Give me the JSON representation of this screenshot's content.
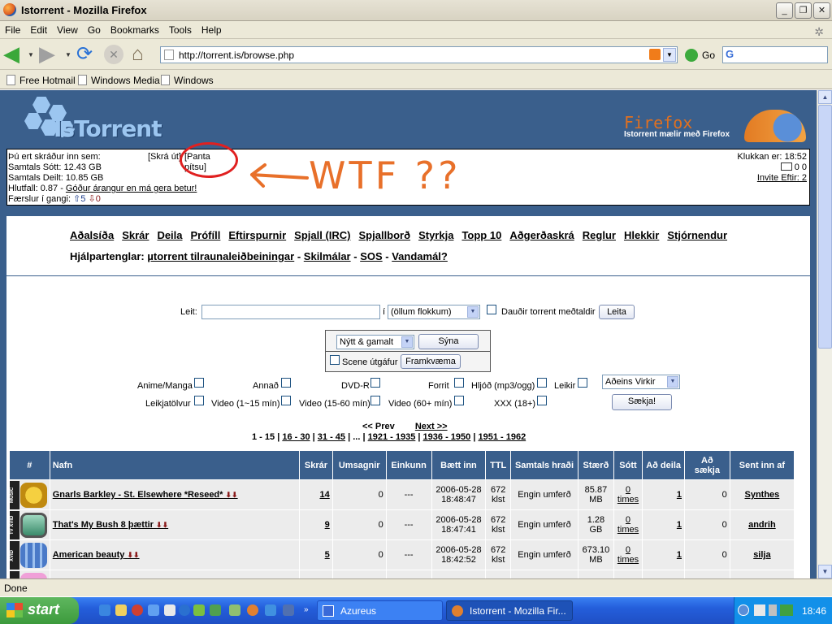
{
  "window": {
    "title": "Istorrent - Mozilla Firefox"
  },
  "menu": [
    "File",
    "Edit",
    "View",
    "Go",
    "Bookmarks",
    "Tools",
    "Help"
  ],
  "address": {
    "url": "http://torrent.is/browse.php",
    "go_label": "Go"
  },
  "bookmarks": [
    "Free Hotmail",
    "Windows Media",
    "Windows"
  ],
  "site": {
    "logo_text": "IsTorrent",
    "firefox_banner": {
      "title": "Firefox",
      "subtitle": "Istorrent mælir með Firefox"
    }
  },
  "userinfo": {
    "logged_in": "Þú ert skráður inn sem:",
    "logout": "[Skrá út]",
    "pizza": "[Panta pítsu]",
    "downloaded": "Samtals Sótt: 12.43 GB",
    "uploaded": "Samtals Deilt: 10.85 GB",
    "ratio_prefix": "Hlutfall: 0.87 - ",
    "ratio_msg": "Góður árangur en má gera betur!",
    "active_prefix": "Færslur í gangi: ",
    "active_up": "⇧5",
    "active_down": "⇩0",
    "clock": "Klukkan er: 18:52",
    "messages": "0 0",
    "invites": "Invite Eftir: 2"
  },
  "annotation": {
    "text": "WTF ??"
  },
  "nav": [
    "Aðalsíða",
    "Skrár",
    "Deila",
    "Prófíll",
    "Eftirspurnir",
    "Spjall (IRC)",
    "Spjallborð",
    "Styrkja",
    "Topp 10",
    "Aðgerðaskrá",
    "Reglur",
    "Hlekkir",
    "Stjórnendur"
  ],
  "help": {
    "prefix": "Hjálpartenglar:",
    "links": [
      "µtorrent tilraunaleiðbeiningar",
      "Skilmálar",
      "SOS",
      "Vandamál?"
    ]
  },
  "search": {
    "label": "Leit:",
    "in_label": "í",
    "category_select": "(öllum flokkum)",
    "dead_label": "Dauðir torrent meðtaldir",
    "button": "Leita",
    "age_select": "Nýtt & gamalt",
    "show_button": "Sýna",
    "scene_label": "Scene útgáfur",
    "execute_button": "Framkvæma"
  },
  "categories": [
    [
      "Anime/Manga",
      "Annað",
      "DVD-R",
      "Forrit",
      "Hljóð (mp3/ogg)",
      "Leikir"
    ],
    [
      "Leikjatölvur",
      "Video (1~15 mín)",
      "Video (15-60 mín)",
      "Video (60+ mín)",
      "XXX (18+)"
    ]
  ],
  "filter": {
    "select": "Aðeins Virkir",
    "button": "Sækja!"
  },
  "pagination": {
    "prev": "<< Prev",
    "next": "Next >>",
    "pages": [
      "1 - 15",
      "16 - 30",
      "31 - 45",
      "...",
      "1921 - 1935",
      "1936 - 1950",
      "1951 - 1962"
    ]
  },
  "table": {
    "headers": [
      "#",
      "Nafn",
      "Skrár",
      "Umsagnir",
      "Einkunn",
      "Bætt inn",
      "TTL",
      "Samtals hraði",
      "Stærð",
      "Sótt",
      "Að deila",
      "Að sækja",
      "Sent inn af"
    ],
    "rows": [
      {
        "cat": "MUSIC",
        "name": "Gnarls Barkley - St. Elsewhere *Reseed*",
        "files": "14",
        "comments": "0",
        "rating": "---",
        "added": "2006-05-28 18:48:47",
        "ttl": "672 klst",
        "speed": "Engin umferð",
        "size": "85.87 MB",
        "snatched": "0 times",
        "seeders": "1",
        "leechers": "0",
        "uploader": "Synthes"
      },
      {
        "cat": "TV XVID",
        "name": "That's My Bush 8 þættir",
        "files": "9",
        "comments": "0",
        "rating": "---",
        "added": "2006-05-28 18:47:41",
        "ttl": "672 klst",
        "speed": "Engin umferð",
        "size": "1.28 GB",
        "snatched": "0 times",
        "seeders": "1",
        "leechers": "0",
        "uploader": "andrih"
      },
      {
        "cat": "XVID",
        "name": "American beauty",
        "files": "5",
        "comments": "0",
        "rating": "---",
        "added": "2006-05-28 18:42:52",
        "ttl": "672 klst",
        "speed": "Engin umferð",
        "size": "673.10 MB",
        "snatched": "0 times",
        "seeders": "1",
        "leechers": "0",
        "uploader": "silja"
      }
    ]
  },
  "statusbar": {
    "text": "Done"
  },
  "taskbar": {
    "start": "start",
    "tasks": [
      "Azureus",
      "Istorrent - Mozilla Fir..."
    ],
    "clock": "18:46"
  },
  "colors": {
    "header_bg": "#3a5f8c",
    "annotation": "#e8702a",
    "circle": "#e02020",
    "row_bg": "#ececec"
  }
}
